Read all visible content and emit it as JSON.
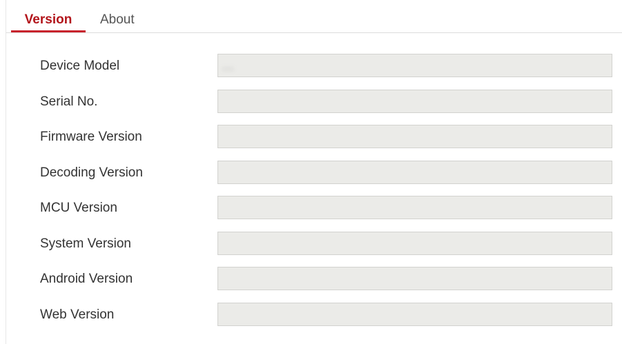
{
  "tabs": {
    "version": "Version",
    "about": "About"
  },
  "fields": [
    {
      "label": "Device Model",
      "value": "..."
    },
    {
      "label": "Serial No.",
      "value": ""
    },
    {
      "label": "Firmware Version",
      "value": ""
    },
    {
      "label": "Decoding Version",
      "value": ""
    },
    {
      "label": "MCU Version",
      "value": ""
    },
    {
      "label": "System Version",
      "value": ""
    },
    {
      "label": "Android Version",
      "value": ""
    },
    {
      "label": "Web Version",
      "value": ""
    }
  ],
  "colors": {
    "accent": "#c8232c",
    "field_bg": "#ebebe8",
    "border": "#dcdcdc"
  }
}
